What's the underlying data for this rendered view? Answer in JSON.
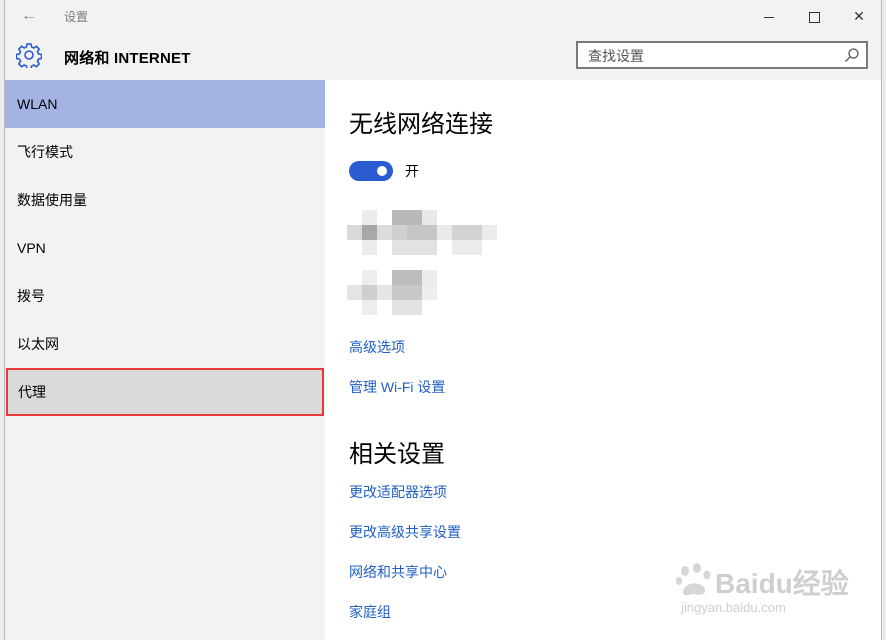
{
  "window": {
    "title": "设置",
    "controls": {
      "minimize": "minimize",
      "maximize": "maximize",
      "close": "close"
    }
  },
  "header": {
    "section_title": "网络和 INTERNET",
    "search_placeholder": "查找设置"
  },
  "sidebar": {
    "items": [
      {
        "label": "WLAN",
        "state": "active"
      },
      {
        "label": "飞行模式",
        "state": "normal"
      },
      {
        "label": "数据使用量",
        "state": "normal"
      },
      {
        "label": "VPN",
        "state": "normal"
      },
      {
        "label": "拨号",
        "state": "normal"
      },
      {
        "label": "以太网",
        "state": "normal"
      },
      {
        "label": "代理",
        "state": "highlighted"
      }
    ]
  },
  "content": {
    "wireless_title": "无线网络连接",
    "toggle_label": "开",
    "toggle_on": true,
    "links": [
      "高级选项",
      "管理 Wi-Fi 设置"
    ],
    "related_title": "相关设置",
    "related_links": [
      "更改适配器选项",
      "更改高级共享设置",
      "网络和共享中心",
      "家庭组"
    ]
  },
  "watermark": {
    "brand": "Baidu经验",
    "url": "jingyan.baidu.com"
  },
  "colors": {
    "accent": "#2b5bd1",
    "link": "#2160c6",
    "nav_active": "#a4b3e3",
    "highlight_border": "#e53a3a"
  }
}
